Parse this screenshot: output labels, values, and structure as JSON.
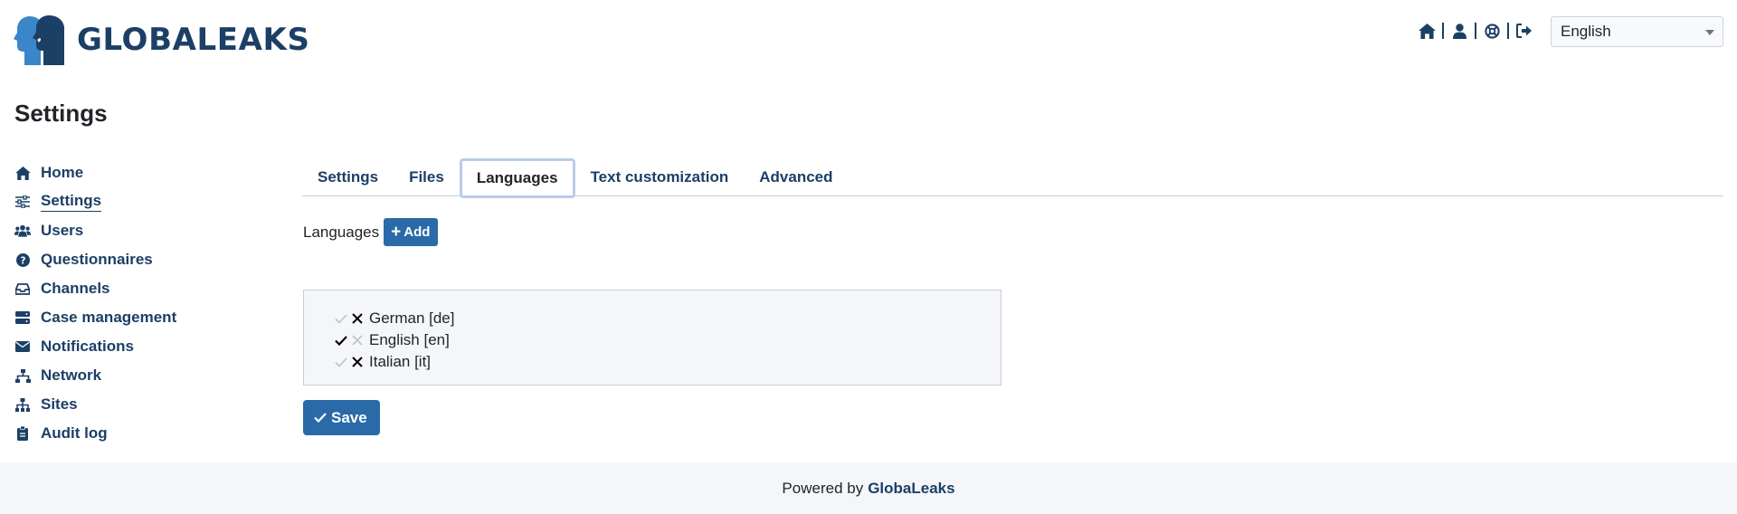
{
  "app": {
    "logo_text": "GLOBALEAKS"
  },
  "header": {
    "icons": [
      "home-icon",
      "user-icon",
      "support-icon",
      "logout-icon"
    ],
    "language_select": {
      "value": "English"
    }
  },
  "page": {
    "title": "Settings"
  },
  "sidebar": {
    "items": [
      {
        "label": "Home",
        "icon": "home-icon"
      },
      {
        "label": "Settings",
        "icon": "sliders-icon",
        "active": true
      },
      {
        "label": "Users",
        "icon": "users-icon"
      },
      {
        "label": "Questionnaires",
        "icon": "question-circle-icon"
      },
      {
        "label": "Channels",
        "icon": "inbox-icon"
      },
      {
        "label": "Case management",
        "icon": "server-icon"
      },
      {
        "label": "Notifications",
        "icon": "envelope-icon"
      },
      {
        "label": "Network",
        "icon": "network-icon"
      },
      {
        "label": "Sites",
        "icon": "sitemap-icon"
      },
      {
        "label": "Audit log",
        "icon": "clipboard-icon"
      }
    ]
  },
  "tabs": [
    {
      "label": "Settings"
    },
    {
      "label": "Files"
    },
    {
      "label": "Languages",
      "active": true
    },
    {
      "label": "Text customization"
    },
    {
      "label": "Advanced"
    }
  ],
  "languages": {
    "label": "Languages",
    "add_label": "Add",
    "list": [
      {
        "name": "German [de]",
        "is_default": false
      },
      {
        "name": "English [en]",
        "is_default": true
      },
      {
        "name": "Italian [it]",
        "is_default": false
      }
    ]
  },
  "save_label": "Save",
  "footer": {
    "powered_by": "Powered by",
    "brand": "GlobaLeaks"
  },
  "colors": {
    "primary": "#1c3f66",
    "button": "#2a6aa8",
    "logo_blue": "#3a86c8"
  }
}
